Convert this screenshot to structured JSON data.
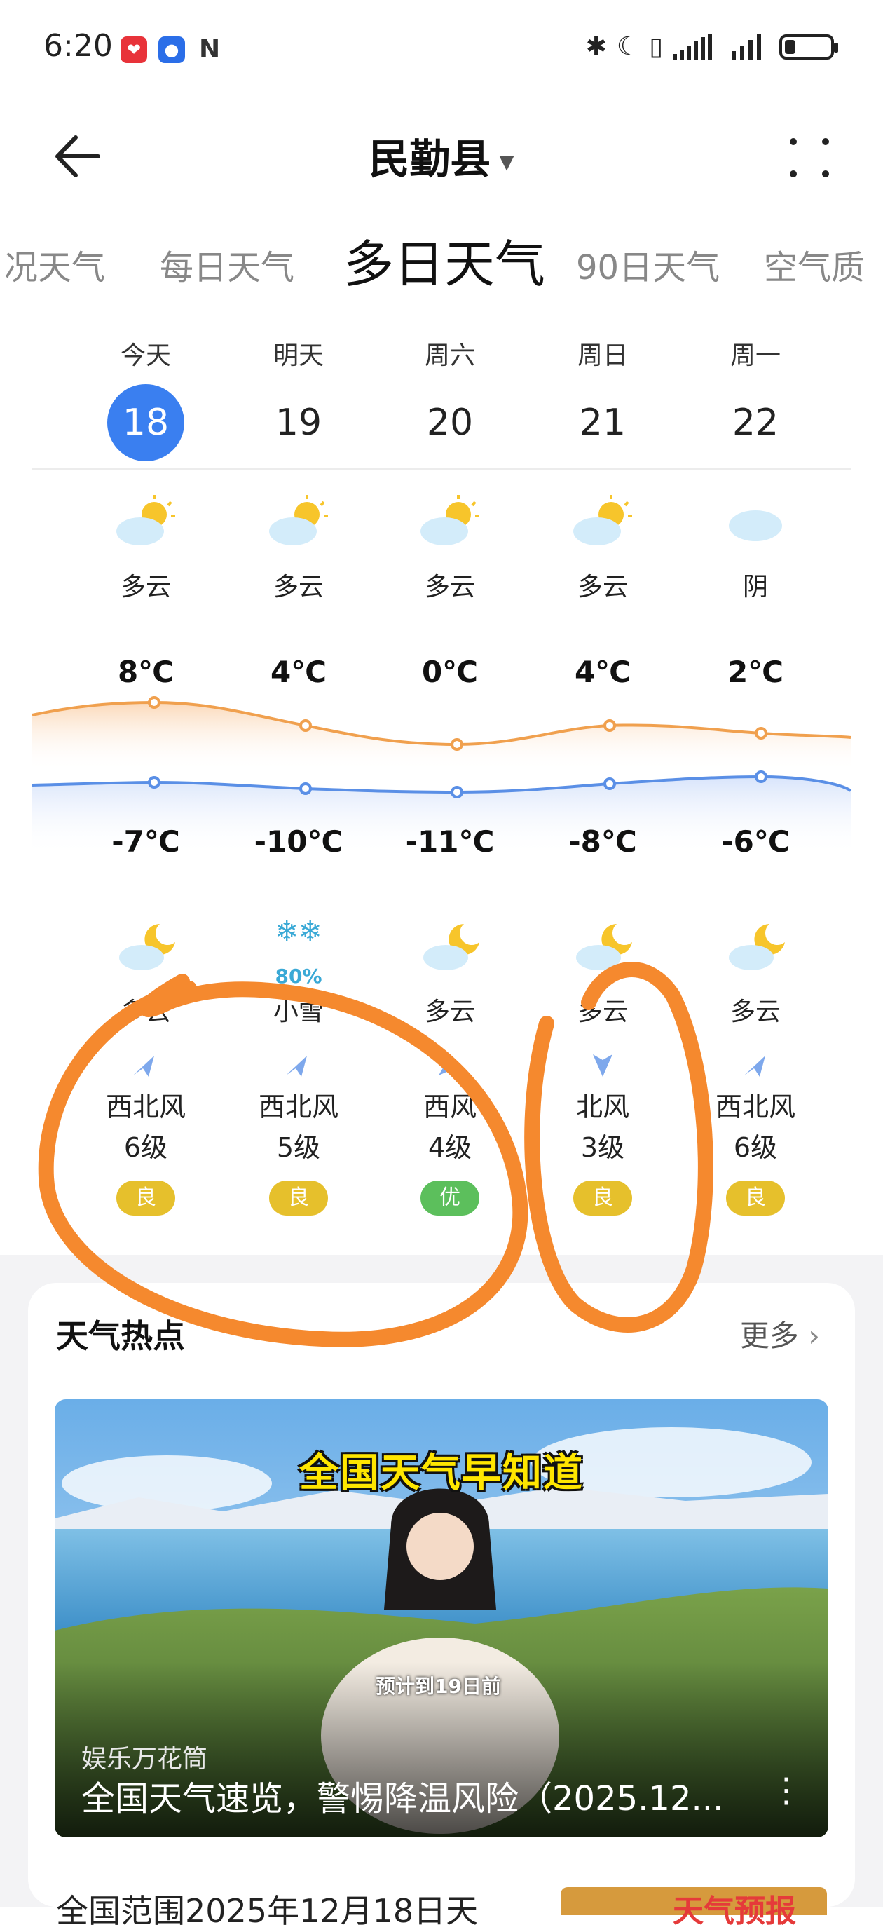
{
  "status_bar": {
    "time": "6:20"
  },
  "header": {
    "city": "民勤县"
  },
  "tabs": [
    {
      "label": "况天气",
      "active": false
    },
    {
      "label": "每日天气",
      "active": false
    },
    {
      "label": "多日天气",
      "active": true
    },
    {
      "label": "90日天气",
      "active": false
    },
    {
      "label": "空气质",
      "active": false
    }
  ],
  "days": [
    {
      "name": "今天",
      "date": "18",
      "day_cond": "多云",
      "high": "8℃",
      "low": "-7℃",
      "night_cond": "多云",
      "wind_dir": "西北风",
      "wind_level": "6级",
      "aqi": "良",
      "aqi_color": "#e6c02c"
    },
    {
      "name": "明天",
      "date": "19",
      "day_cond": "多云",
      "high": "4℃",
      "low": "-10℃",
      "night_cond": "小雪",
      "precip": "80%",
      "wind_dir": "西北风",
      "wind_level": "5级",
      "aqi": "良",
      "aqi_color": "#e6c02c"
    },
    {
      "name": "周六",
      "date": "20",
      "day_cond": "多云",
      "high": "0℃",
      "low": "-11℃",
      "night_cond": "多云",
      "wind_dir": "西风",
      "wind_level": "4级",
      "aqi": "优",
      "aqi_color": "#5cbf5c"
    },
    {
      "name": "周日",
      "date": "21",
      "day_cond": "多云",
      "high": "4℃",
      "low": "-8℃",
      "night_cond": "多云",
      "wind_dir": "北风",
      "wind_level": "3级",
      "aqi": "良",
      "aqi_color": "#e6c02c"
    },
    {
      "name": "周一",
      "date": "22",
      "day_cond": "阴",
      "high": "2℃",
      "low": "-6℃",
      "night_cond": "多云",
      "wind_dir": "西北风",
      "wind_level": "6级",
      "aqi": "良",
      "aqi_color": "#e6c02c"
    }
  ],
  "hot": {
    "title": "天气热点",
    "more": "更多",
    "video": {
      "banner": "全国天气早知道",
      "caption": "预计到19日前",
      "source": "娱乐万花筒",
      "title": "全国天气速览，警惕降温风险（2025.12..."
    },
    "next_item": "全国范围2025年12月18日天",
    "next_thumb_text": "天气预报"
  },
  "colors": {
    "accent": "#3a7ff0",
    "high_line": "#f0a04e",
    "low_line": "#5a8fe6",
    "annotation": "#f5892e"
  }
}
